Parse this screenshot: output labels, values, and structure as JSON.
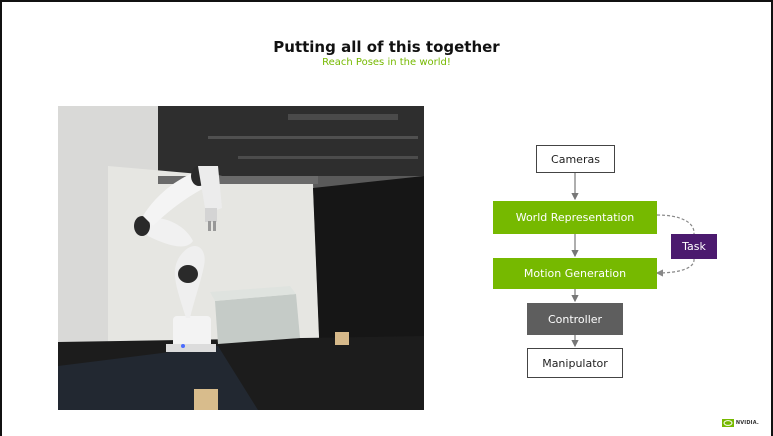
{
  "slide": {
    "title": "Putting all of this together",
    "subtitle": "Reach Poses in the world!"
  },
  "diagram": {
    "cameras": "Cameras",
    "world_representation": "World Representation",
    "task": "Task",
    "motion_generation": "Motion Generation",
    "controller": "Controller",
    "manipulator": "Manipulator"
  },
  "logo": {
    "text": "NVIDIA."
  },
  "colors": {
    "accent_green": "#76b900",
    "task_purple": "#4b1a6e",
    "controller_gray": "#5e5e5e"
  }
}
